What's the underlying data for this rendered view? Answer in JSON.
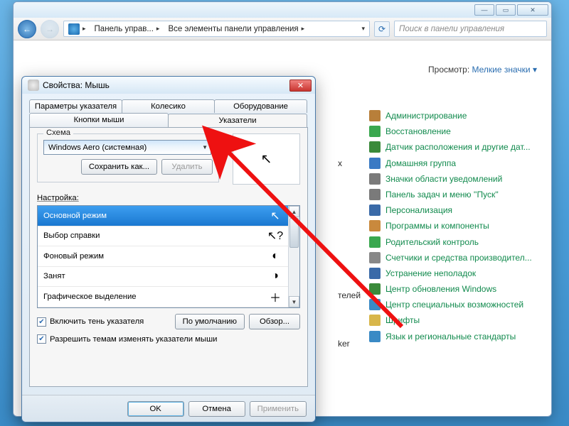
{
  "explorer": {
    "nav": {
      "back_icon": "←",
      "fwd_icon": "→"
    },
    "address": {
      "seg1": "Панель управ...",
      "seg2": "Все элементы панели управления"
    },
    "search_placeholder": "Поиск в панели управления",
    "view": {
      "label": "Просмотр:",
      "value": "Мелкие значки ▾"
    },
    "peek1": "х",
    "peek2": "телей",
    "peek3": "ker",
    "items": [
      {
        "label": "Администрирование",
        "color": "#b87f3a"
      },
      {
        "label": "Восстановление",
        "color": "#3aa84f"
      },
      {
        "label": "Датчик расположения и другие дат...",
        "color": "#3a8a3a"
      },
      {
        "label": "Домашняя группа",
        "color": "#3a7ac4"
      },
      {
        "label": "Значки области уведомлений",
        "color": "#7a7a7a"
      },
      {
        "label": "Панель задач и меню ''Пуск''",
        "color": "#7a7a7a"
      },
      {
        "label": "Персонализация",
        "color": "#3a6aa8"
      },
      {
        "label": "Программы и компоненты",
        "color": "#c9893d"
      },
      {
        "label": "Родительский контроль",
        "color": "#3aa84f"
      },
      {
        "label": "Счетчики и средства производител...",
        "color": "#888"
      },
      {
        "label": "Устранение неполадок",
        "color": "#3a6aa8"
      },
      {
        "label": "Центр обновления Windows",
        "color": "#3a8a3a"
      },
      {
        "label": "Центр специальных возможностей",
        "color": "#3a8ac5"
      },
      {
        "label": "Шрифты",
        "color": "#d8b64a"
      },
      {
        "label": "Язык и региональные стандарты",
        "color": "#3a8ac5"
      }
    ]
  },
  "dialog": {
    "title": "Свойства: Мышь",
    "tabs_top": [
      "Параметры указателя",
      "Колесико",
      "Оборудование"
    ],
    "tabs_bottom": [
      "Кнопки мыши",
      "Указатели"
    ],
    "active_tab": "Указатели",
    "scheme_group": "Схема",
    "scheme_value": "Windows Aero (системная)",
    "save_as": "Сохранить как...",
    "delete": "Удалить",
    "customize_label": "Настройка:",
    "cursor_items": [
      {
        "label": "Основной режим",
        "icon": "↖",
        "selected": true
      },
      {
        "label": "Выбор справки",
        "icon": "↖?",
        "selected": false
      },
      {
        "label": "Фоновый режим",
        "icon": "◐",
        "selected": false
      },
      {
        "label": "Занят",
        "icon": "◑",
        "selected": false
      },
      {
        "label": "Графическое выделение",
        "icon": "＋",
        "selected": false
      }
    ],
    "chk_shadow": "Включить тень указателя",
    "chk_themes": "Разрешить темам изменять указатели мыши",
    "defaults": "По умолчанию",
    "browse": "Обзор...",
    "ok": "OK",
    "cancel": "Отмена",
    "apply": "Применить"
  }
}
